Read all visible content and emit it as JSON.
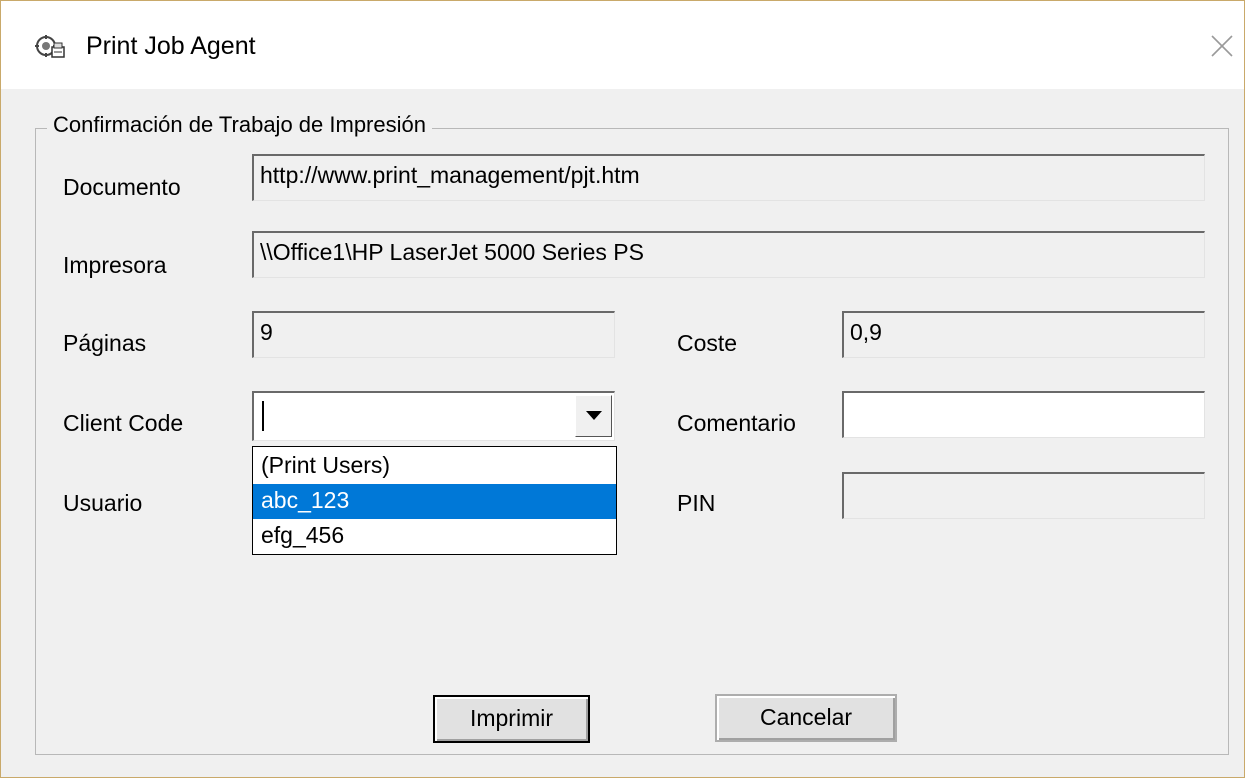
{
  "window": {
    "title": "Print Job Agent",
    "icon": "print-agent-icon",
    "close_icon": "close-icon"
  },
  "group": {
    "legend": "Confirmación de Trabajo de Impresión"
  },
  "fields": {
    "documento": {
      "label": "Documento",
      "value": "http://www.print_management/pjt.htm"
    },
    "impresora": {
      "label": "Impresora",
      "value": "\\\\Office1\\HP LaserJet 5000 Series PS"
    },
    "paginas": {
      "label": "Páginas",
      "value": "9"
    },
    "coste": {
      "label": "Coste",
      "value": "0,9"
    },
    "client_code": {
      "label": "Client Code",
      "value": ""
    },
    "comentario": {
      "label": "Comentario",
      "value": ""
    },
    "usuario": {
      "label": "Usuario"
    },
    "pin": {
      "label": "PIN",
      "value": ""
    }
  },
  "dropdown": {
    "options": [
      "(Print Users)",
      "abc_123",
      "efg_456"
    ],
    "selected_index": 1
  },
  "buttons": {
    "print": "Imprimir",
    "cancel": "Cancelar"
  },
  "colors": {
    "selection": "#0078d7",
    "window_bg": "#f0f0f0",
    "title_bg": "#ffffff"
  }
}
